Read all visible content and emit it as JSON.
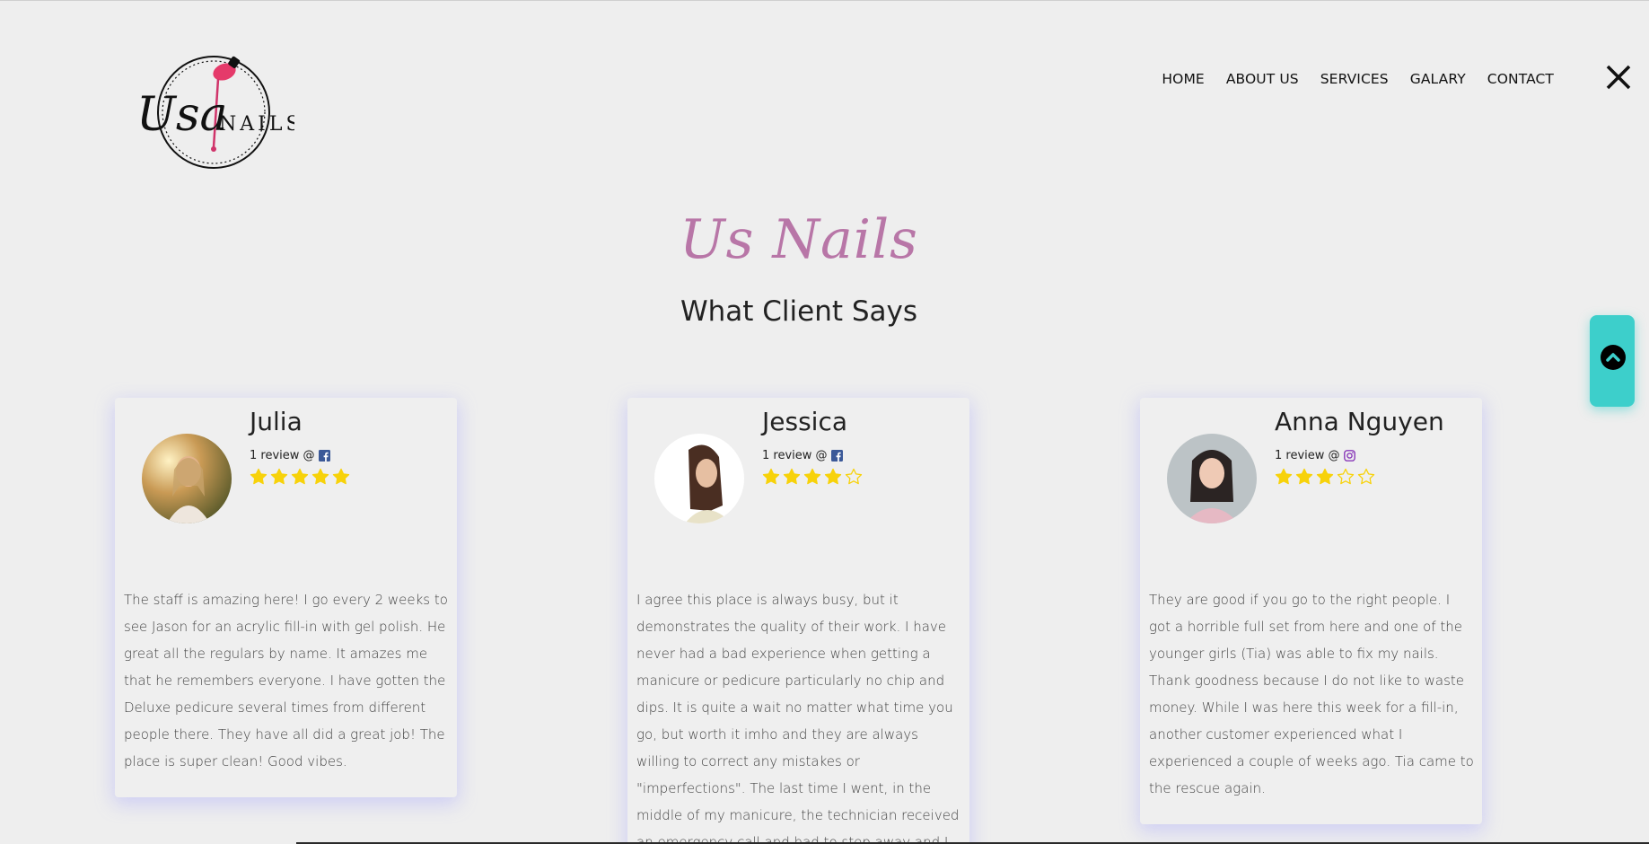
{
  "brand": {
    "logo_text": "UsaNAILS"
  },
  "nav": {
    "items": [
      "HOME",
      "ABOUT US",
      "SERVICES",
      "GALARY",
      "CONTACT"
    ]
  },
  "hero": {
    "script_title": "Us Nails",
    "section_title": "What Client Says"
  },
  "reviews": [
    {
      "name": "Julia",
      "meta": "1 review @",
      "source_icon": "facebook-icon",
      "rating": 5,
      "text": "The staff is amazing here! I go every 2 weeks to see Jason for an acrylic fill-in with gel polish. He great all the regulars by name. It amazes me that he remembers everyone. I have gotten the Deluxe pedicure several times from different people there. They have all did a great job! The place is super clean! Good vibes."
    },
    {
      "name": "Jessica",
      "meta": "1 review @",
      "source_icon": "facebook-icon",
      "rating": 4,
      "text": "I agree this place is always busy, but it demonstrates the quality of their work. I have never had a bad experience when getting a manicure or pedicure particularly no chip and dips. It is quite a wait no matter what time you go, but worth it imho and they are always willing to correct any mistakes or \"imperfections\". The last time I went, in the middle of my manicure, the technician received an emergency call and had to step away and I had to wait for someone"
    },
    {
      "name": "Anna Nguyen",
      "meta": "1 review @",
      "source_icon": "instagram-icon",
      "rating": 3,
      "text": "They are good if you go to the right people. I got a horrible full set from here and one of the younger girls (Tia) was able to fix my nails. Thank goodness because I do not like to waste money. While I was here this week for a fill-in, another customer experienced what I experienced a couple of weeks ago. Tia came to the rescue again."
    }
  ],
  "colors": {
    "background": "#eeeeee",
    "script_title": "#b876a7",
    "star": "#f7d20a",
    "scroll_button": "#3dcfcb",
    "facebook": "#3b5998",
    "instagram": "#8a3ab9"
  }
}
